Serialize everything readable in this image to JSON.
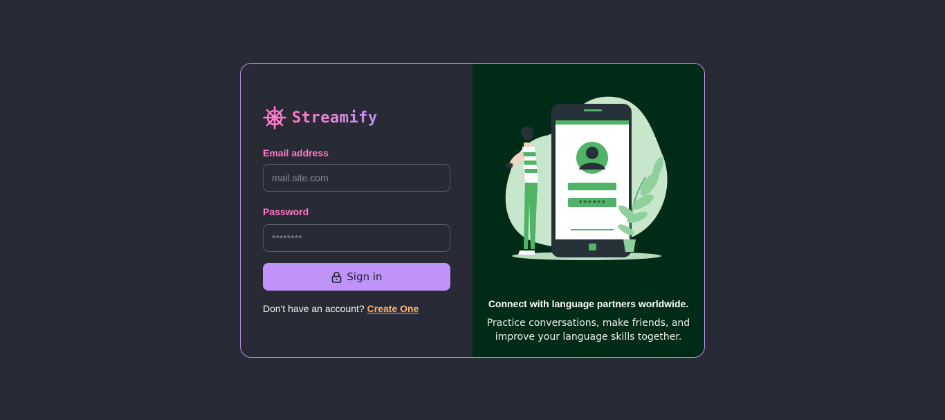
{
  "brand": {
    "name": "Streamify",
    "icon": "ship-wheel-icon",
    "color_start": "#ff79c6",
    "color_end": "#bd93f9"
  },
  "form": {
    "email_label": "Email address",
    "email_placeholder": "mail.site.com",
    "email_value": "",
    "password_label": "Password",
    "password_placeholder": "********",
    "password_value": "",
    "submit_label": "Sign in",
    "submit_icon": "lock-icon",
    "signup_prompt": "Don't have an account?",
    "signup_link": "Create One"
  },
  "promo": {
    "illustration": "phone-login-illustration",
    "headline": "Connect with language partners worldwide.",
    "subtext": "Practice conversations, make friends, and improve your language skills together.",
    "password_mask": "******"
  },
  "colors": {
    "background": "#282a36",
    "accent": "#c093f8",
    "label": "#ff79c6",
    "link": "#ffb86c",
    "promo_background": "#002b17",
    "illustration_green": "#4fb466"
  }
}
